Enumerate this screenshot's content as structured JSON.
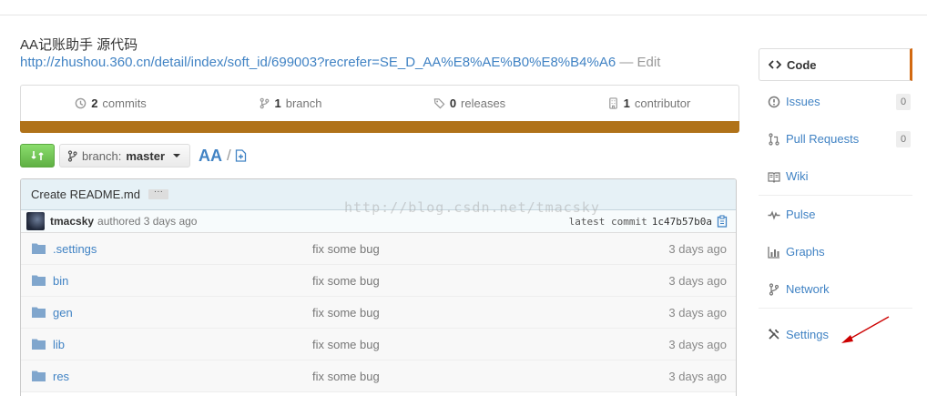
{
  "repo": {
    "title": "AA记账助手 源代码",
    "url": "http://zhushou.360.cn/detail/index/soft_id/699003?recrefer=SE_D_AA%E8%AE%B0%E8%B4%A6",
    "edit_label": "— Edit"
  },
  "stats": {
    "commits_count": "2",
    "commits_label": "commits",
    "branch_count": "1",
    "branch_label": "branch",
    "releases_count": "0",
    "releases_label": "releases",
    "contributor_count": "1",
    "contributor_label": "contributor",
    "language_color": "#b07219"
  },
  "toolbar": {
    "branch_prefix": "branch:",
    "branch_name": "master",
    "repo_crumb": "AA",
    "crumb_separator": "/"
  },
  "commit": {
    "message": "Create README.md",
    "ellipsis": "···",
    "author": "tmacsky",
    "authored": "authored 3 days ago",
    "latest_label": "latest commit",
    "sha": "1c47b57b0a"
  },
  "files": [
    {
      "name": ".settings",
      "message": "fix some bug",
      "age": "3 days ago"
    },
    {
      "name": "bin",
      "message": "fix some bug",
      "age": "3 days ago"
    },
    {
      "name": "gen",
      "message": "fix some bug",
      "age": "3 days ago"
    },
    {
      "name": "lib",
      "message": "fix some bug",
      "age": "3 days ago"
    },
    {
      "name": "res",
      "message": "fix some bug",
      "age": "3 days ago"
    }
  ],
  "sidebar": {
    "code": "Code",
    "issues": "Issues",
    "issues_count": "0",
    "pull_requests": "Pull Requests",
    "pull_requests_count": "0",
    "wiki": "Wiki",
    "pulse": "Pulse",
    "graphs": "Graphs",
    "network": "Network",
    "settings": "Settings",
    "accent_color": "#d26911"
  },
  "watermark": "http://blog.csdn.net/tmacsky",
  "colors": {
    "link": "#4183c4",
    "compare_green": "#60b044",
    "annotation_arrow": "#cc0000"
  }
}
